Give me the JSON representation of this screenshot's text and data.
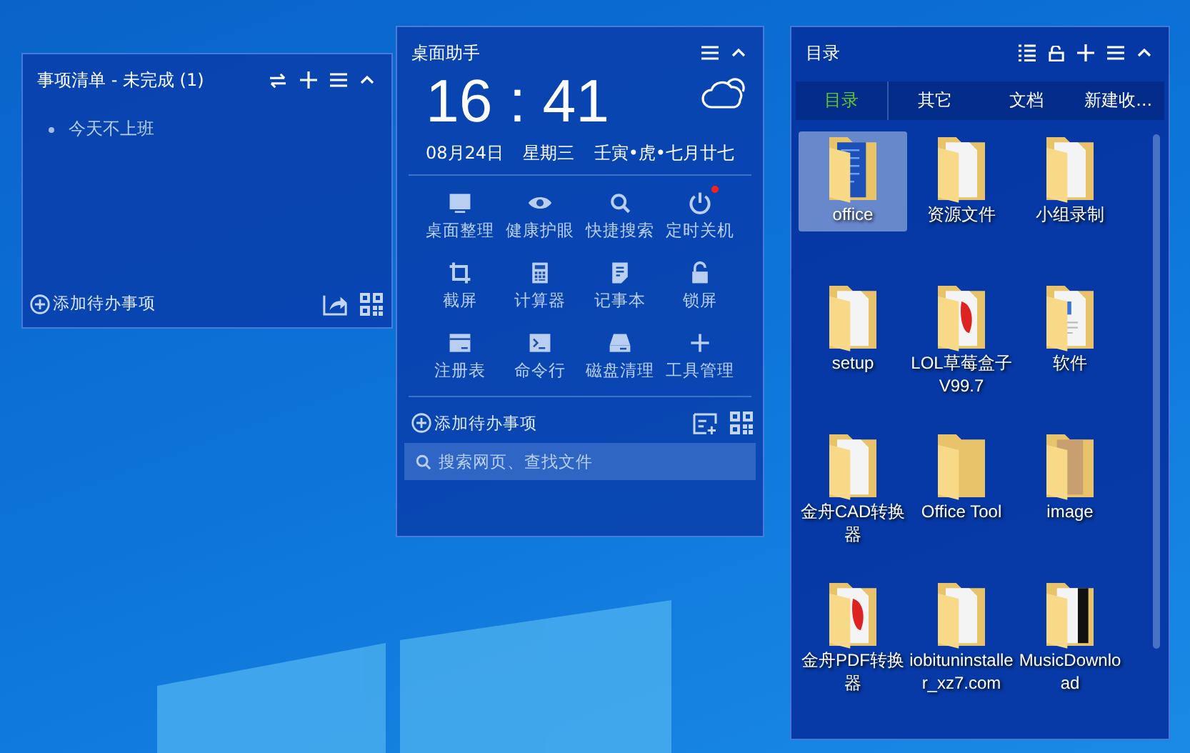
{
  "todo_panel": {
    "title": "事项清单 - 未完成 (1)",
    "items": [
      {
        "text": "今天不上班"
      }
    ],
    "add_label": "添加待办事项"
  },
  "assistant_panel": {
    "title": "桌面助手",
    "time": "16 : 41",
    "date": "08月24日",
    "weekday": "星期三",
    "lunar": "壬寅•虎•七月廿七",
    "tools": [
      {
        "label": "桌面整理",
        "kind": "monitor",
        "alert": false
      },
      {
        "label": "健康护眼",
        "kind": "eye",
        "alert": false
      },
      {
        "label": "快捷搜索",
        "kind": "search",
        "alert": false
      },
      {
        "label": "定时关机",
        "kind": "power",
        "alert": true
      },
      {
        "label": "截屏",
        "kind": "crop",
        "alert": false
      },
      {
        "label": "计算器",
        "kind": "calculator",
        "alert": false
      },
      {
        "label": "记事本",
        "kind": "note",
        "alert": false
      },
      {
        "label": "锁屏",
        "kind": "lock",
        "alert": false
      },
      {
        "label": "注册表",
        "kind": "registry",
        "alert": false
      },
      {
        "label": "命令行",
        "kind": "terminal",
        "alert": false
      },
      {
        "label": "磁盘清理",
        "kind": "disk",
        "alert": false
      },
      {
        "label": "工具管理",
        "kind": "plus",
        "alert": false
      }
    ],
    "add_label": "添加待办事项",
    "search": {
      "placeholder": "搜索网页、查找文件"
    }
  },
  "directory_panel": {
    "title": "目录",
    "tabs": [
      {
        "label": "目录",
        "selected": true
      },
      {
        "label": "其它",
        "selected": false
      },
      {
        "label": "文档",
        "selected": false
      },
      {
        "label": "新建收...",
        "selected": false
      }
    ],
    "files": [
      {
        "name": "office",
        "kind": "blue",
        "selected": true
      },
      {
        "name": "资源文件",
        "kind": "paper",
        "selected": false
      },
      {
        "name": "小组录制",
        "kind": "paper",
        "selected": false
      },
      {
        "name": "setup",
        "kind": "paper",
        "selected": false
      },
      {
        "name": "LOL草莓盒子V99.7",
        "kind": "red",
        "selected": false
      },
      {
        "name": "软件",
        "kind": "word",
        "selected": false
      },
      {
        "name": "金舟CAD转换器",
        "kind": "paper",
        "selected": false
      },
      {
        "name": "Office Tool",
        "kind": "plain",
        "selected": false
      },
      {
        "name": "image",
        "kind": "photo",
        "selected": false
      },
      {
        "name": "金舟PDF转换器",
        "kind": "red",
        "selected": false
      },
      {
        "name": "iobituninstaller_xz7.com",
        "kind": "paper",
        "selected": false
      },
      {
        "name": "MusicDownload",
        "kind": "dark",
        "selected": false
      }
    ]
  }
}
